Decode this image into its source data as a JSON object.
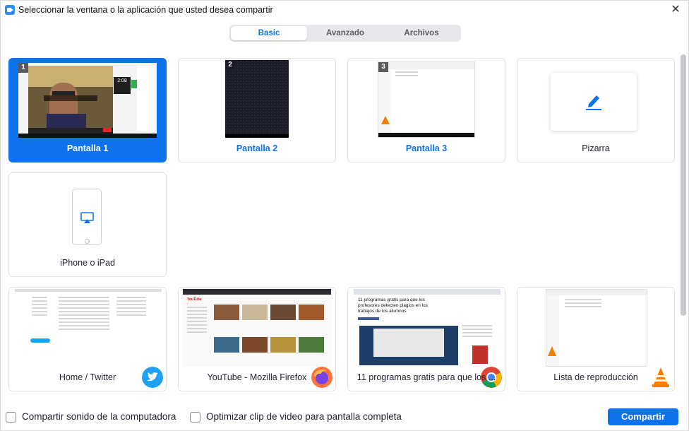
{
  "window": {
    "title": "Seleccionar la ventana o la aplicación que usted desea compartir",
    "close_glyph": "✕"
  },
  "tabs": [
    {
      "label": "Basic",
      "active": true
    },
    {
      "label": "Avanzado",
      "active": false
    },
    {
      "label": "Archivos",
      "active": false
    }
  ],
  "screens": [
    {
      "label": "Pantalla 1",
      "number": "1",
      "selected": true
    },
    {
      "label": "Pantalla 2",
      "number": "2",
      "selected": false
    },
    {
      "label": "Pantalla 3",
      "number": "3",
      "selected": false
    }
  ],
  "whiteboard": {
    "label": "Pizarra",
    "icon": "pencil-icon"
  },
  "iphone": {
    "label": "iPhone o iPad",
    "icon": "airplay-icon"
  },
  "apps": [
    {
      "label": "Home / Twitter",
      "icon": "twitter-icon",
      "color": "#1da1f2"
    },
    {
      "label": "YouTube - Mozilla Firefox",
      "icon": "firefox-icon",
      "color": "#ff7139"
    },
    {
      "label": "11 programas gratis para que los ...",
      "icon": "chrome-icon",
      "color": "#4285f4"
    },
    {
      "label": "Lista de reproducción",
      "icon": "vlc-icon",
      "color": "#f08000"
    }
  ],
  "thumb_text": {
    "article": "11 programas gratis para que los profesores detecten plagios en los trabajos de los alumnos",
    "clock": "2:08",
    "youtube": "YouTube"
  },
  "options": {
    "share_sound": {
      "label": "Compartir sonido de la computadora",
      "checked": false
    },
    "optimize_video": {
      "label": "Optimizar clip de video para pantalla completa",
      "checked": false
    }
  },
  "share_button": "Compartir",
  "colors": {
    "accent": "#0e72ed",
    "selected_bg": "#0e72ed"
  }
}
